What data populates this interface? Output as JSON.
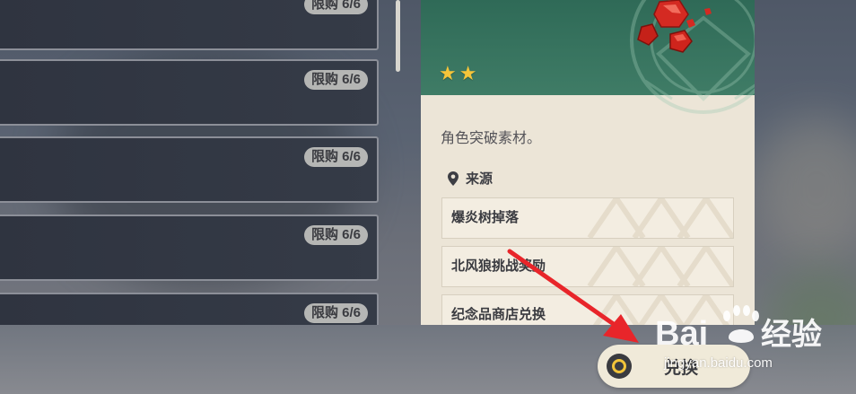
{
  "shop_list": {
    "items": [
      {
        "limit": "限购 6/6"
      },
      {
        "limit": "限购 6/6"
      },
      {
        "limit": "限购 6/6"
      },
      {
        "limit": "限购 6/6"
      },
      {
        "limit": "限购 6/6"
      }
    ]
  },
  "detail": {
    "rarity_stars": 2,
    "description": "角色突破素材。",
    "source_title": "来源",
    "sources": [
      "爆炎树掉落",
      "北风狼挑战奖励",
      "纪念品商店兑换"
    ]
  },
  "exchange_button": {
    "label": "兑换"
  },
  "watermark": {
    "logo": "Baidu经验",
    "url": "jingyan.baidu.com"
  },
  "colors": {
    "panel_header": "#2f6a57",
    "panel_body": "#ece5d7",
    "star": "#f5c53a",
    "arrow": "#e8252a"
  }
}
